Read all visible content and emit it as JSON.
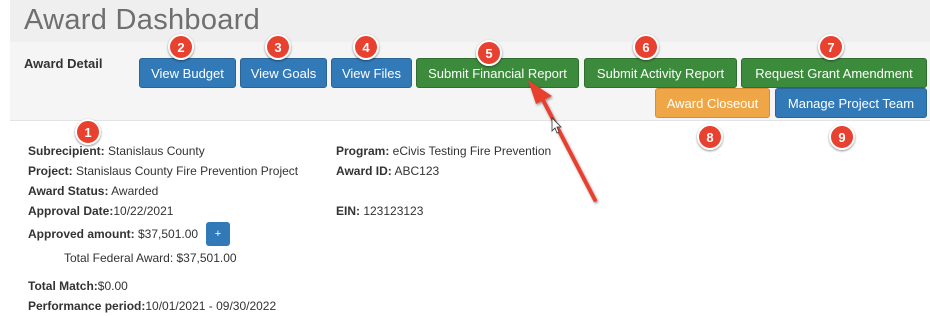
{
  "page_title": "Award Dashboard",
  "award_detail_label": "Award Detail",
  "buttons": {
    "view_budget": "View Budget",
    "view_goals": "View Goals",
    "view_files": "View Files",
    "submit_financial_report": "Submit Financial Report",
    "submit_activity_report": "Submit Activity Report",
    "request_grant_amendment": "Request Grant Amendment",
    "award_closeout": "Award Closeout",
    "manage_project_team": "Manage Project Team",
    "add_amount": "+"
  },
  "badges": [
    "1",
    "2",
    "3",
    "4",
    "5",
    "6",
    "7",
    "8",
    "9"
  ],
  "details": {
    "subrecipient": {
      "label": "Subrecipient:",
      "value": " Stanislaus County"
    },
    "project": {
      "label": "Project:",
      "value": " Stanislaus County Fire Prevention Project"
    },
    "award_status": {
      "label": "Award Status:",
      "value": " Awarded"
    },
    "approval_date": {
      "label": "Approval Date:",
      "value": "10/22/2021"
    },
    "approved_amount": {
      "label": "Approved amount:",
      "value": " $37,501.00"
    },
    "total_federal_award": "Total Federal Award: $37,501.00",
    "total_match": {
      "label": "Total Match:",
      "value": "$0.00"
    },
    "performance_period": {
      "label": "Performance period:",
      "value": "10/01/2021 - 09/30/2022"
    },
    "program": {
      "label": "Program:",
      "value": " eCivis Testing Fire Prevention"
    },
    "award_id": {
      "label": "Award ID:",
      "value": " ABC123"
    },
    "ein": {
      "label": "EIN:",
      "value": " 123123123"
    }
  },
  "colors": {
    "primary_blue": "#3279b7",
    "success_green": "#3c8a3b",
    "warning_orange": "#eea647",
    "badge_red": "#e8412f",
    "arrow_red": "#e8412f"
  }
}
